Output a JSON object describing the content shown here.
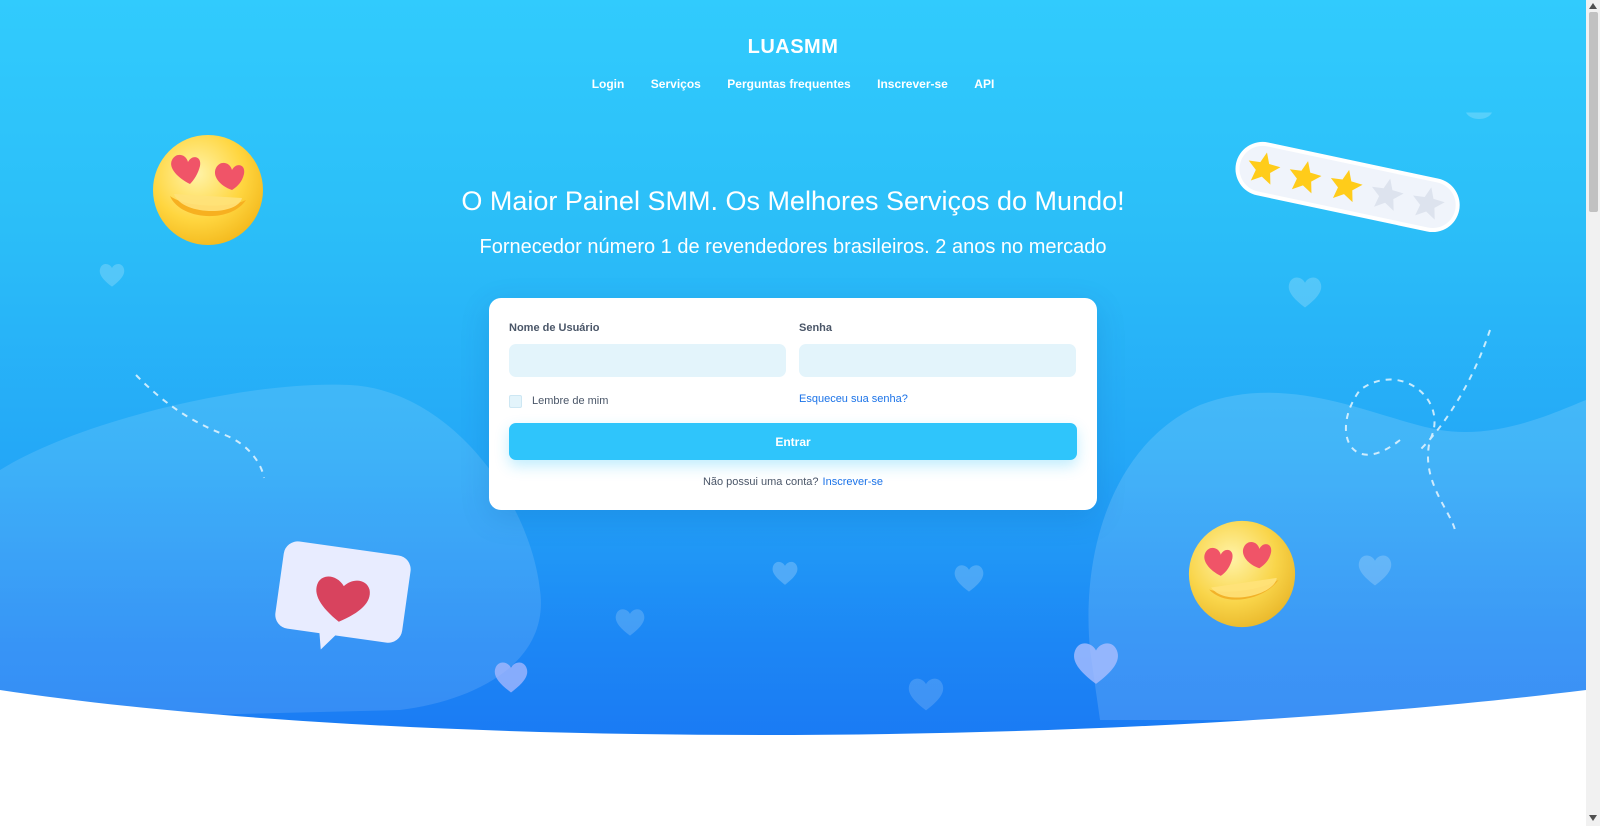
{
  "brand": {
    "name": "LUASMM"
  },
  "nav": {
    "items": [
      "Login",
      "Serviços",
      "Perguntas frequentes",
      "Inscrever-se",
      "API"
    ]
  },
  "hero": {
    "headline": "O Maior Painel SMM. Os Melhores Serviços do Mundo!",
    "subline": "Fornecedor número 1 de revendedores brasileiros. 2 anos no mercado"
  },
  "login_form": {
    "username_label": "Nome de Usuário",
    "username_value": "",
    "password_label": "Senha",
    "password_value": "",
    "remember_label": "Lembre de mim",
    "forgot_label": "Esqueceu sua senha?",
    "submit_label": "Entrar",
    "no_account_text": "Não possui uma conta?",
    "signup_label": "Inscrever-se"
  },
  "rating_decoration": {
    "filled_stars": 3,
    "total_stars": 5
  },
  "colors": {
    "hero_top": "#31cbfd",
    "hero_bottom": "#1a78f3",
    "button": "#2fc5fb",
    "link": "#1b73e8",
    "input_bg": "#e3f4fb"
  },
  "icons": [
    "heart-eyes-emoji-icon",
    "star-rating-icon",
    "heart-chat-bubble-icon",
    "heart-icon"
  ]
}
